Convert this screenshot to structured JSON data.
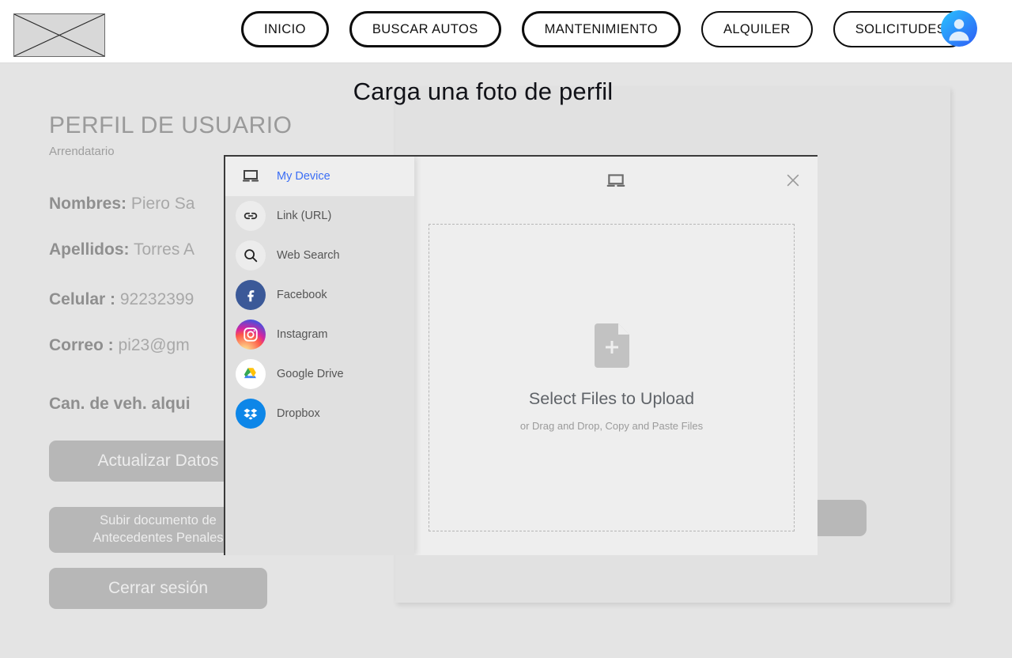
{
  "header": {
    "logo_alt": "broken-image-placeholder",
    "nav_items": [
      {
        "label": "INICIO",
        "weight": "thick"
      },
      {
        "label": "BUSCAR AUTOS",
        "weight": "thick"
      },
      {
        "label": "MANTENIMIENTO",
        "weight": "thick"
      },
      {
        "label": "ALQUILER",
        "weight": "thin"
      },
      {
        "label": "SOLICITUDES",
        "weight": "thin"
      }
    ],
    "avatar_icon": "user-avatar-icon"
  },
  "page": {
    "title": "Carga una foto de perfil"
  },
  "profile": {
    "heading": "PERFIL DE USUARIO",
    "subheading": "Arrendatario",
    "fields": [
      {
        "label": "Nombres:",
        "value": "Piero Sa"
      },
      {
        "label": "Apellidos:",
        "value": "Torres A"
      },
      {
        "label": "Celular :",
        "value": "92232399"
      },
      {
        "label": "Correo :",
        "value": "pi23@gm"
      },
      {
        "label": "Can. de veh. alqui",
        "value": ""
      }
    ],
    "buttons": {
      "update": "Actualizar Datos",
      "upload_doc": "Subir documento de\nAntecedentes Penales",
      "logout": "Cerrar sesión"
    }
  },
  "uploader": {
    "sources": [
      {
        "label": "My Device",
        "icon": "laptop-icon",
        "active": true
      },
      {
        "label": "Link (URL)",
        "icon": "link-icon",
        "active": false
      },
      {
        "label": "Web Search",
        "icon": "search-icon",
        "active": false
      },
      {
        "label": "Facebook",
        "icon": "facebook-icon",
        "active": false
      },
      {
        "label": "Instagram",
        "icon": "instagram-icon",
        "active": false
      },
      {
        "label": "Google Drive",
        "icon": "google-drive-icon",
        "active": false
      },
      {
        "label": "Dropbox",
        "icon": "dropbox-icon",
        "active": false
      }
    ],
    "header_icon": "laptop-icon",
    "close_icon": "close-icon",
    "dropzone": {
      "file_icon": "file-add-icon",
      "title": "Select Files to Upload",
      "subtitle": "or Drag and Drop, Copy and Paste Files"
    }
  },
  "colors": {
    "accent_blue": "#3b6ef5",
    "panel": "#e1e1e1",
    "modal_bg": "#eeeeee",
    "modal_sidebar": "#e0e0e0",
    "button_grey": "#b7b7b7",
    "text_grey": "#9e9e9e"
  }
}
